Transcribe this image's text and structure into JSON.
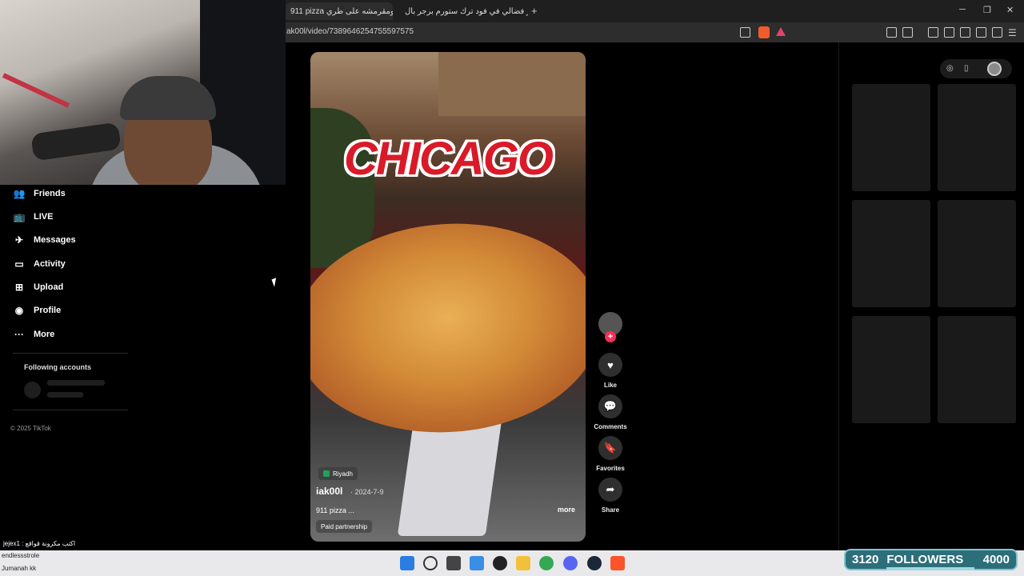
{
  "browser": {
    "tabs": [
      {
        "title": "911 pizza ومقرمشه على طري",
        "active": true
      },
      {
        "title": "برجر فضالي في فود ترك ستورم برجر بال",
        "active": false
      }
    ],
    "url": "ak00l/video/7389646254755597575",
    "window_controls": {
      "minimize": "─",
      "restore": "❐",
      "close": "✕"
    },
    "new_tab": "+"
  },
  "sidebar": {
    "items": [
      {
        "label": "Friends",
        "icon": "friends-icon",
        "glyph": "👥"
      },
      {
        "label": "LIVE",
        "icon": "live-icon",
        "glyph": "📺"
      },
      {
        "label": "Messages",
        "icon": "messages-icon",
        "glyph": "✈"
      },
      {
        "label": "Activity",
        "icon": "activity-icon",
        "glyph": "▭"
      },
      {
        "label": "Upload",
        "icon": "upload-icon",
        "glyph": "⊞"
      },
      {
        "label": "Profile",
        "icon": "profile-icon",
        "glyph": "◉"
      },
      {
        "label": "More",
        "icon": "more-icon",
        "glyph": "···"
      }
    ],
    "following_title": "Following accounts",
    "copyright": "© 2025 TikTok"
  },
  "video": {
    "overlay_text": "CHICAGO",
    "location": "Riyadh",
    "author": "iak00l",
    "date": "· 2024-7-9",
    "description": "911 pizza ...",
    "more_label": "more",
    "paid_label": "Paid partnership"
  },
  "actions": {
    "follow_glyph": "+",
    "like": {
      "label": "Like",
      "glyph": "♥"
    },
    "comments": {
      "label": "Comments",
      "glyph": "💬"
    },
    "favorites": {
      "label": "Favorites",
      "glyph": "🔖"
    },
    "share": {
      "label": "Share",
      "glyph": "➦"
    }
  },
  "chat": {
    "line1": "jejex1 : اكتب مكرونة قواقع",
    "line2": "endlessstrole",
    "line3": "Jumanah kk"
  },
  "followers": {
    "count": "3120",
    "label": "FOLLOWERS",
    "goal": "4000",
    "progress": 0.78
  },
  "colors": {
    "accent": "#fe2c55",
    "chicago_red": "#d91a28",
    "followers_bg": "#2c6e7a"
  }
}
